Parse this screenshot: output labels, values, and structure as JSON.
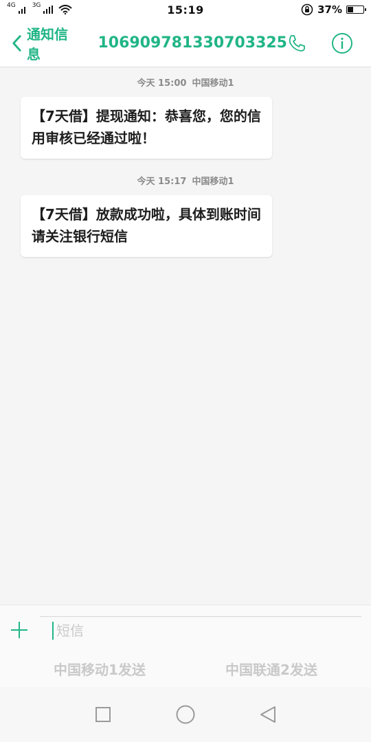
{
  "status_bar": {
    "signal1_label": "4G",
    "signal2_label": "3G",
    "time": "15:19",
    "battery_percent": "37%",
    "battery_level": 0.37,
    "icons": [
      "signal-icon",
      "wifi-icon",
      "lock-rotation-icon",
      "battery-icon"
    ]
  },
  "header": {
    "back_label": "通知信息",
    "title": "106909781330703325",
    "icons": [
      "back-chevron-icon",
      "phone-icon",
      "info-icon"
    ]
  },
  "messages": [
    {
      "time": "今天 15:00",
      "carrier": "中国移动1",
      "text": "【7天借】提现通知：恭喜您，您的信用审核已经通过啦！"
    },
    {
      "time": "今天 15:17",
      "carrier": "中国移动1",
      "text": "【7天借】放款成功啦，具体到账时间请关注银行短信"
    }
  ],
  "compose": {
    "placeholder": "短信",
    "send_sim1": "中国移动1发送",
    "send_sim2": "中国联通2发送"
  },
  "colors": {
    "accent": "#21b586",
    "background": "#f5f5f5",
    "bubble": "#ffffff",
    "muted": "#c9c9c9"
  },
  "nav_bar": {
    "icons": [
      "recents-square-icon",
      "home-circle-icon",
      "back-triangle-icon"
    ]
  }
}
